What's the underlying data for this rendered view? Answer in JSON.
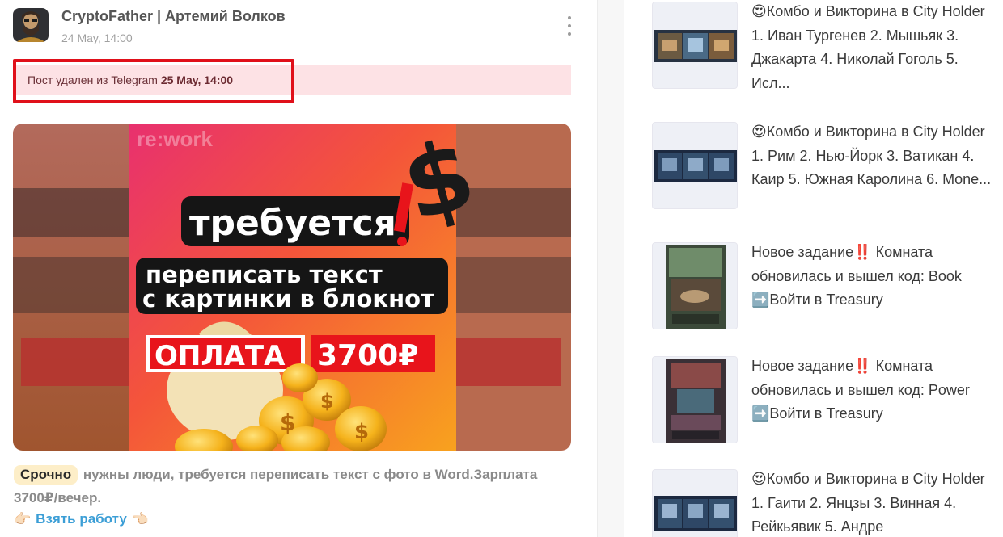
{
  "post": {
    "author": "CryptoFather | Артемий Волков",
    "time": "24 May, 14:00",
    "deleted_prefix": "Пост удален из Telegram ",
    "deleted_date": "25 May, 14:00",
    "image": {
      "brand": "re:work",
      "headline": "требуется",
      "subline_1": "переписать текст",
      "subline_2": "с картинки в блокнот",
      "pay_label": "ОПЛАТА",
      "pay_amount": "3700₽"
    },
    "urgent_tag": "Срочно",
    "body_text": " нужны люди, требуется переписать текст с фото в Word.Зарплата 3700₽/вечер.",
    "cta_hand_left": "👉🏻",
    "cta_label": "Взять работу",
    "cta_hand_right": "👈🏻"
  },
  "feed": {
    "items": [
      {
        "text": "😍Комбо и Викторина в City Holder 1. Иван Тургенев 2. Мышьяк 3. Джакарта 4. Николай Гоголь 5. Исл..."
      },
      {
        "text": "😍Комбо и Викторина в City Holder 1. Рим 2. Нью-Йорк 3. Ватикан 4. Каир 5. Южная Каролина 6. Mone..."
      },
      {
        "text": "Новое задание‼️ Комната обновилась и вышел код: Book ➡️Войти в Treasury"
      },
      {
        "text": "Новое задание‼️ Комната обновилась и вышел код: Power ➡️Войти в Treasury"
      },
      {
        "text": "😍Комбо и Викторина в City Holder 1. Гаити 2. Янцзы 3. Винная 4. Рейкьявик 5. Андре"
      }
    ]
  },
  "colors": {
    "notice_bg": "#fde2e5",
    "highlight": "#e0101a",
    "link": "#3b9ed6",
    "urgent_bg": "#fdeec8"
  }
}
